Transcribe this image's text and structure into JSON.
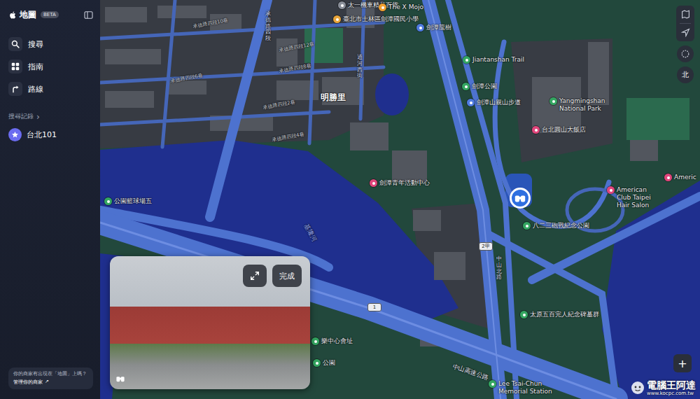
{
  "app": {
    "title": "地圖",
    "badge": "BETA"
  },
  "sidebar": {
    "items": [
      {
        "label": "搜尋",
        "selected": false
      },
      {
        "label": "指南",
        "selected": false
      },
      {
        "label": "路線",
        "selected": false
      }
    ],
    "history_title": "搜尋記錄",
    "history_chevron": "›",
    "history": [
      {
        "label": "台北101"
      }
    ],
    "business": {
      "question": "你的商家有出現在「地圖」上嗎？",
      "link": "管理你的商家",
      "link_icon": "↗"
    }
  },
  "map": {
    "labels": [
      {
        "text": "太一機車精品百貨",
        "kind": "poi",
        "color": "#8a8f99"
      },
      {
        "text": "The X Mojo",
        "kind": "poi",
        "color": "#f0a030"
      },
      {
        "text": "臺北市士林區劍潭國民小學",
        "kind": "poi",
        "color": "#e8a53a"
      },
      {
        "text": "劍潭龍樹",
        "kind": "poi",
        "color": "#4f7be0"
      },
      {
        "text": "Jiantanshan Trail",
        "kind": "poi",
        "color": "#34a661"
      },
      {
        "text": "劍潭公園",
        "kind": "poi",
        "color": "#34a661"
      },
      {
        "text": "劍潭山親山步道",
        "kind": "poi",
        "color": "#4f7be0"
      },
      {
        "text": "Yangmingshan National Park",
        "kind": "poi",
        "color": "#34a661"
      },
      {
        "text": "台北圓山大飯店",
        "kind": "poi",
        "color": "#e0457b"
      },
      {
        "text": "劍潭青年活動中心",
        "kind": "poi",
        "color": "#e0457b"
      },
      {
        "text": "American Club Taipei Hair Salon",
        "kind": "poi",
        "color": "#e0457b"
      },
      {
        "text": "Americ",
        "kind": "poi",
        "color": "#e0457b"
      },
      {
        "text": "八二三砲戰紀念公園",
        "kind": "poi",
        "color": "#34a661"
      },
      {
        "text": "太原五百完人紀念碑墓群",
        "kind": "poi",
        "color": "#34a661"
      },
      {
        "text": "Lee Tsai-Chun Memorial Station",
        "kind": "poi",
        "color": "#34a661"
      },
      {
        "text": "公園籃球場五",
        "kind": "poi",
        "color": "#34a661"
      },
      {
        "text": "樂中心會址",
        "kind": "poi",
        "color": "#34a661"
      },
      {
        "text": "公園",
        "kind": "poi",
        "color": "#34a661"
      },
      {
        "text": "承德路四段",
        "kind": "vroad"
      },
      {
        "text": "承德路四段10巷",
        "kind": "street"
      },
      {
        "text": "承德路四段12巷",
        "kind": "street"
      },
      {
        "text": "承德路四段6巷",
        "kind": "street"
      },
      {
        "text": "承德路四段8巷",
        "kind": "street"
      },
      {
        "text": "承德路四段2巷",
        "kind": "street"
      },
      {
        "text": "承德路四段4巷",
        "kind": "street"
      },
      {
        "text": "通河西街",
        "kind": "vroad"
      },
      {
        "text": "明勝里",
        "kind": "area"
      },
      {
        "text": "基隆河",
        "kind": "water"
      },
      {
        "text": "中山北路",
        "kind": "vroad"
      },
      {
        "text": "中山高速公路",
        "kind": "road"
      }
    ],
    "shields": [
      "2甲",
      "1"
    ],
    "compass": "北",
    "zoom_in": "+"
  },
  "look_around": {
    "done": "完成"
  },
  "watermark": {
    "text": "電腦王阿達",
    "url": "www.kocpc.com.tw"
  }
}
